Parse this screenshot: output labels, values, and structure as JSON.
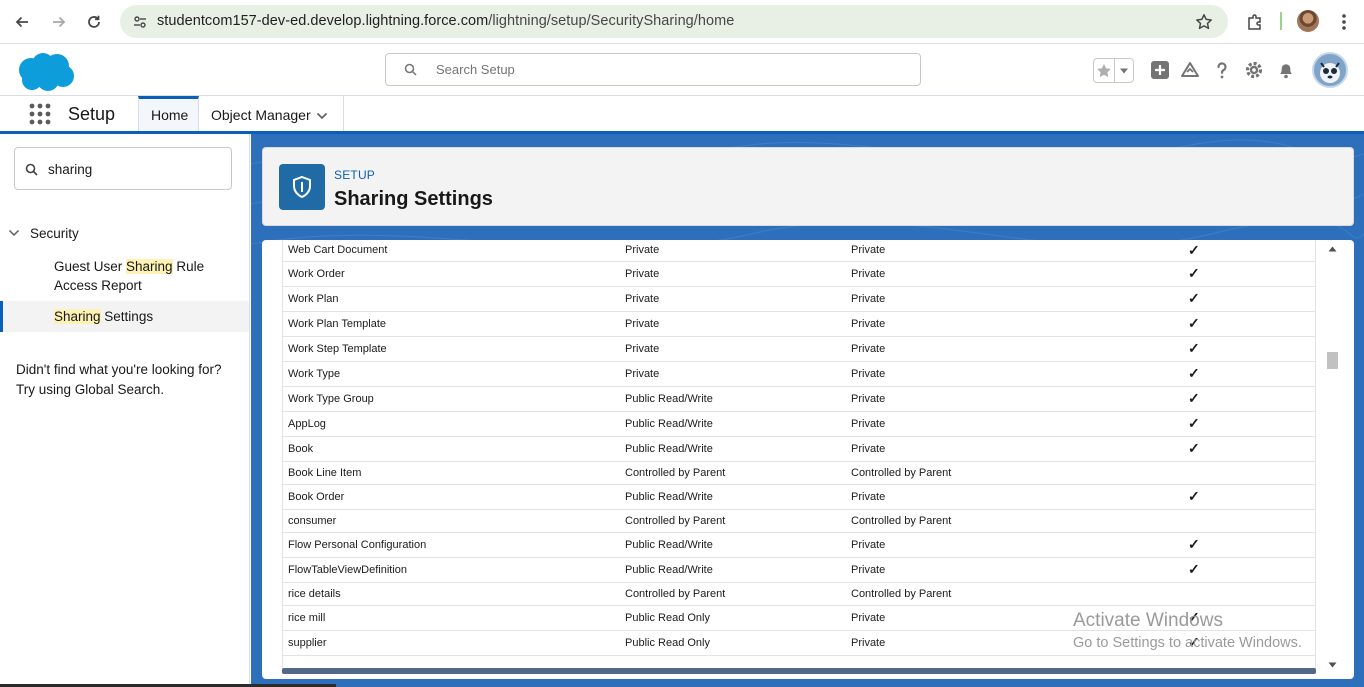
{
  "browser": {
    "url_host": "studentcom157-dev-ed.develop.lightning.force.com",
    "url_path": "/lightning/setup/SecuritySharing/home"
  },
  "header": {
    "search_placeholder": "Search Setup"
  },
  "context_bar": {
    "app_name": "Setup",
    "tabs": [
      {
        "label": "Home",
        "active": true
      },
      {
        "label": "Object Manager",
        "active": false
      }
    ]
  },
  "sidebar": {
    "quickfind_value": "sharing",
    "section": "Security",
    "items": [
      {
        "pre": "Guest User ",
        "match": "Sharing",
        "post": " Rule Access Report"
      },
      {
        "pre": "",
        "match": "Sharing",
        "post": " Settings"
      }
    ],
    "help_line1": "Didn't find what you're looking for?",
    "help_line2": "Try using Global Search."
  },
  "page_header": {
    "eyebrow": "SETUP",
    "title": "Sharing Settings"
  },
  "table": {
    "rows": [
      {
        "object": "Web Cart Document",
        "internal": "Private",
        "external": "Private",
        "check": "✓"
      },
      {
        "object": "Work Order",
        "internal": "Private",
        "external": "Private",
        "check": "✓"
      },
      {
        "object": "Work Plan",
        "internal": "Private",
        "external": "Private",
        "check": "✓"
      },
      {
        "object": "Work Plan Template",
        "internal": "Private",
        "external": "Private",
        "check": "✓"
      },
      {
        "object": "Work Step Template",
        "internal": "Private",
        "external": "Private",
        "check": "✓"
      },
      {
        "object": "Work Type",
        "internal": "Private",
        "external": "Private",
        "check": "✓"
      },
      {
        "object": "Work Type Group",
        "internal": "Public Read/Write",
        "external": "Private",
        "check": "✓"
      },
      {
        "object": "AppLog",
        "internal": "Public Read/Write",
        "external": "Private",
        "check": "✓"
      },
      {
        "object": "Book",
        "internal": "Public Read/Write",
        "external": "Private",
        "check": "✓"
      },
      {
        "object": "Book Line Item",
        "internal": "Controlled by Parent",
        "external": "Controlled by Parent",
        "check": ""
      },
      {
        "object": "Book Order",
        "internal": "Public Read/Write",
        "external": "Private",
        "check": "✓"
      },
      {
        "object": "consumer",
        "internal": "Controlled by Parent",
        "external": "Controlled by Parent",
        "check": ""
      },
      {
        "object": "Flow Personal Configuration",
        "internal": "Public Read/Write",
        "external": "Private",
        "check": "✓"
      },
      {
        "object": "FlowTableViewDefinition",
        "internal": "Public Read/Write",
        "external": "Private",
        "check": "✓"
      },
      {
        "object": "rice details",
        "internal": "Controlled by Parent",
        "external": "Controlled by Parent",
        "check": ""
      },
      {
        "object": "rice mill",
        "internal": "Public Read Only",
        "external": "Private",
        "check": "✓"
      },
      {
        "object": "supplier",
        "internal": "Public Read Only",
        "external": "Private",
        "check": "✓"
      }
    ]
  },
  "watermark": {
    "line1": "Activate Windows",
    "line2": "Go to Settings to activate Windows."
  },
  "colors": {
    "brand_blue": "#0a60b8",
    "header_icon_blue": "#206aa5",
    "background_blue": "#2769b7",
    "highlight": "#fdf2b3"
  },
  "icons": [
    "back-arrow-icon",
    "forward-arrow-icon",
    "reload-icon",
    "site-info-icon",
    "bookmark-star-icon",
    "extensions-icon",
    "browser-menu-icon",
    "salesforce-cloud-logo",
    "search-icon",
    "favorites-star-icon",
    "add-icon",
    "trailhead-icon",
    "help-icon",
    "gear-icon",
    "bell-icon",
    "app-launcher-icon",
    "shield-icon"
  ]
}
